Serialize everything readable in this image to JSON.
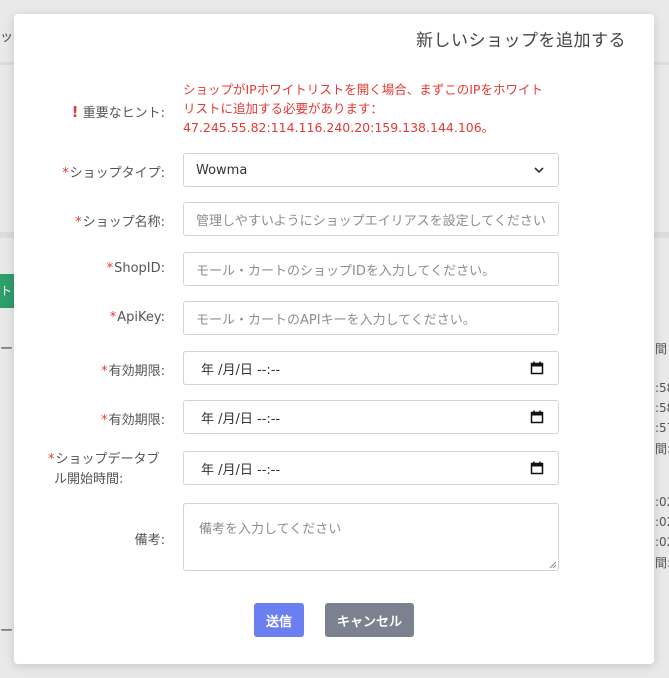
{
  "background": {
    "frag_top_left": "ッ",
    "frag_green": "ト",
    "frag_mid_left": "ー",
    "frag_bottom_left": "ー",
    "frag_right": [
      "間",
      ":58",
      ":58",
      ":57",
      "間:",
      ":02",
      ":02",
      ":02",
      "間:"
    ]
  },
  "modal": {
    "title": "新しいショップを追加する",
    "hint": {
      "icon": "!",
      "label": "重要なヒント:",
      "text_line1": "ショップがIPホワイトリストを開く場合、まずこのIPをホワイト",
      "text_line2": "リストに追加する必要があります：",
      "text_line3": "47.245.55.82:114.116.240.20:159.138.144.106。"
    },
    "fields": {
      "shop_type": {
        "label": "ショップタイプ:",
        "value": "Wowma"
      },
      "shop_name": {
        "label": "ショップ名称:",
        "placeholder": "管理しやすいようにショップエイリアスを設定してください。"
      },
      "shop_id": {
        "label": "ShopID:",
        "placeholder": "モール・カートのショップIDを入力してください。"
      },
      "api_key": {
        "label": "ApiKey:",
        "placeholder": "モール・カートのAPIキーを入力してください。"
      },
      "expiry1": {
        "label": "有効期限:",
        "value": "年 /月/日 --:--"
      },
      "expiry2": {
        "label": "有効期限:",
        "value": "年 /月/日 --:--"
      },
      "table_start": {
        "label_line1": "ショップデータブ",
        "label_line2": "ル開始時間:",
        "value": "年 /月/日 --:--"
      },
      "remarks": {
        "label": "備考:",
        "placeholder": "備考を入力してください"
      }
    },
    "required_mark": "*",
    "buttons": {
      "submit": "送信",
      "cancel": "キャンセル"
    }
  }
}
